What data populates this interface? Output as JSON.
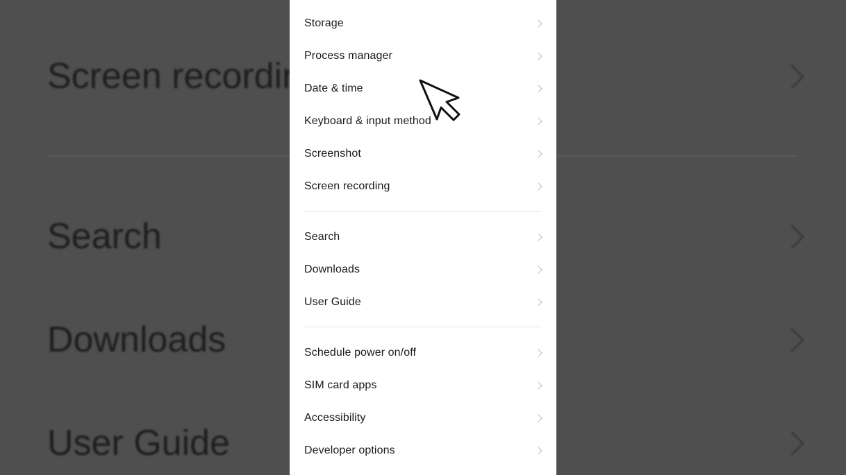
{
  "background_items": [
    "Screen recording",
    "Search",
    "Downloads",
    "User Guide"
  ],
  "settings": {
    "group1": [
      {
        "label": "Storage"
      },
      {
        "label": "Process manager"
      },
      {
        "label": "Date & time"
      },
      {
        "label": "Keyboard & input method"
      },
      {
        "label": "Screenshot"
      },
      {
        "label": "Screen recording"
      }
    ],
    "group2": [
      {
        "label": "Search"
      },
      {
        "label": "Downloads"
      },
      {
        "label": "User Guide"
      }
    ],
    "group3": [
      {
        "label": "Schedule power on/off"
      },
      {
        "label": "SIM card apps"
      },
      {
        "label": "Accessibility"
      },
      {
        "label": "Developer options"
      }
    ]
  },
  "icons": {
    "row_chevron": "chevron-right-icon",
    "pointer": "mouse-pointer-icon"
  },
  "colors": {
    "panel_bg": "#ffffff",
    "backdrop": "#4d4d4d",
    "text": "#1a1a1a",
    "chevron": "#b9b9b9"
  }
}
